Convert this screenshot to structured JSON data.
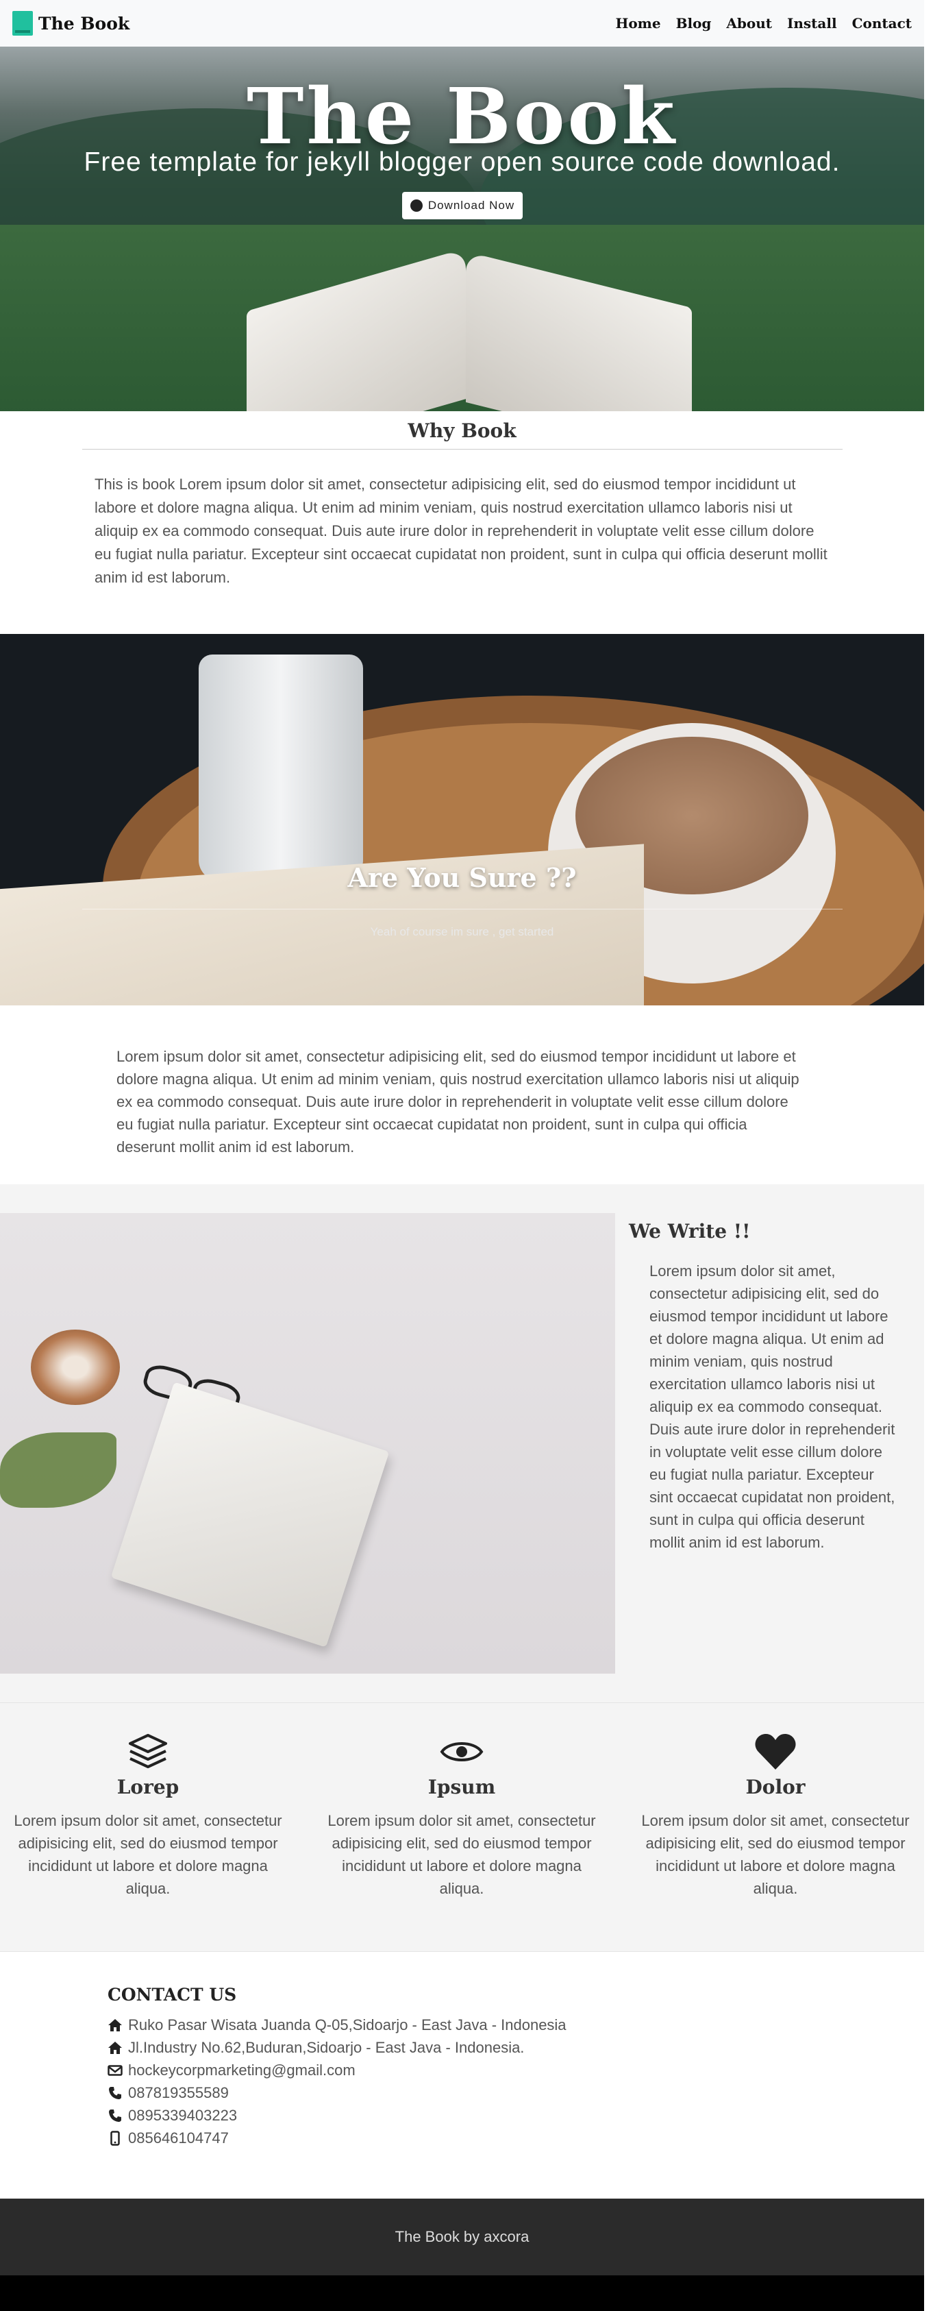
{
  "nav": {
    "brand": "The Book",
    "links": [
      "Home",
      "Blog",
      "About",
      "Install",
      "Contact"
    ]
  },
  "hero": {
    "title": "The Book",
    "subtitle": "Free template for jekyll blogger open source code download.",
    "button": "Download Now"
  },
  "why": {
    "title": "Why Book",
    "text": "This is book Lorem ipsum dolor sit amet, consectetur adipisicing elit, sed do eiusmod tempor incididunt ut labore et dolore magna aliqua. Ut enim ad minim veniam, quis nostrud exercitation ullamco laboris nisi ut aliquip ex ea commodo consequat. Duis aute irure dolor in reprehenderit in voluptate velit esse cillum dolore eu fugiat nulla pariatur. Excepteur sint occaecat cupidatat non proident, sunt in culpa qui officia deserunt mollit anim id est laborum."
  },
  "sure": {
    "title": "Are You Sure ??",
    "subtitle": "Yeah of course im sure , get started",
    "text": "Lorem ipsum dolor sit amet, consectetur adipisicing elit, sed do eiusmod tempor incididunt ut labore et dolore magna aliqua. Ut enim ad minim veniam, quis nostrud exercitation ullamco laboris nisi ut aliquip ex ea commodo consequat. Duis aute irure dolor in reprehenderit in voluptate velit esse cillum dolore eu fugiat nulla pariatur. Excepteur sint occaecat cupidatat non proident, sunt in culpa qui officia deserunt mollit anim id est laborum."
  },
  "write": {
    "title": "We Write !!",
    "text": "Lorem ipsum dolor sit amet, consectetur adipisicing elit, sed do eiusmod tempor incididunt ut labore et dolore magna aliqua. Ut enim ad minim veniam, quis nostrud exercitation ullamco laboris nisi ut aliquip ex ea commodo consequat. Duis aute irure dolor in reprehenderit in voluptate velit esse cillum dolore eu fugiat nulla pariatur. Excepteur sint occaecat cupidatat non proident, sunt in culpa qui officia deserunt mollit anim id est laborum."
  },
  "features": [
    {
      "icon": "layers-icon",
      "title": "Lorep",
      "text": "Lorem ipsum dolor sit amet, consectetur adipisicing elit, sed do eiusmod tempor incididunt ut labore et dolore magna aliqua."
    },
    {
      "icon": "eye-icon",
      "title": "Ipsum",
      "text": "Lorem ipsum dolor sit amet, consectetur adipisicing elit, sed do eiusmod tempor incididunt ut labore et dolore magna aliqua."
    },
    {
      "icon": "heart-icon",
      "title": "Dolor",
      "text": "Lorem ipsum dolor sit amet, consectetur adipisicing elit, sed do eiusmod tempor incididunt ut labore et dolore magna aliqua."
    }
  ],
  "contact": {
    "title": "CONTACT US",
    "items": [
      {
        "icon": "home-icon",
        "text": "Ruko Pasar Wisata Juanda Q-05,Sidoarjo - East Java - Indonesia"
      },
      {
        "icon": "home-icon",
        "text": "Jl.Industry No.62,Buduran,Sidoarjo - East Java - Indonesia."
      },
      {
        "icon": "envelope-icon",
        "text": "hockeycorpmarketing@gmail.com"
      },
      {
        "icon": "phone-icon",
        "text": "087819355589"
      },
      {
        "icon": "phone-icon",
        "text": "0895339403223"
      },
      {
        "icon": "mobile-icon",
        "text": "085646104747"
      }
    ]
  },
  "footer": {
    "text": "The Book by axcora"
  },
  "colors": {
    "brand": "#20c09e",
    "footer": "#2b2b2b",
    "section": "#f4f4f4"
  }
}
